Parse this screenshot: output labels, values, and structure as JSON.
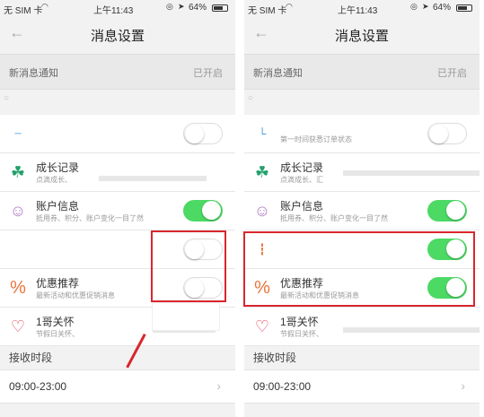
{
  "status_bar": {
    "carrier": "无 SIM 卡",
    "time": "上午11:43",
    "battery": "64%"
  },
  "nav": {
    "title": "消息设置"
  },
  "notice": {
    "label": "新消息通知",
    "value": "已开启"
  },
  "left": {
    "top_partial_desc": "",
    "items": [
      {
        "name": "成长记录",
        "desc": "点滴成长、"
      },
      {
        "name": "账户信息",
        "desc": "抵用券、积分、账户变化一目了然"
      },
      {
        "name": "",
        "desc": ""
      },
      {
        "name": "优惠推荐",
        "desc": "最新活动和优惠促销消息"
      },
      {
        "name": "1哥关怀",
        "desc": "节假日关怀、"
      }
    ]
  },
  "right": {
    "top_partial_desc": "第一时间获悉订单状态",
    "items": [
      {
        "name": "成长记录",
        "desc": "点滴成长、汇"
      },
      {
        "name": "账户信息",
        "desc": "抵用券、积分、账户变化一目了然"
      },
      {
        "name": "",
        "desc": ""
      },
      {
        "name": "优惠推荐",
        "desc": "最新活动和优惠促销消息"
      },
      {
        "name": "1哥关怀",
        "desc": "节假日关怀、"
      }
    ]
  },
  "receive": {
    "section_title": "接收时段",
    "value": "09:00-23:00"
  },
  "toggles": {
    "left": [
      false,
      false,
      true,
      false,
      false
    ],
    "right": [
      false,
      false,
      true,
      true,
      true
    ]
  },
  "colors": {
    "accent_green": "#4cd964",
    "highlight_red": "#d9262c"
  },
  "icons": {
    "back": "back-arrow-icon",
    "growth": "sprout-icon",
    "account": "person-icon",
    "promo": "percent-icon",
    "care": "heart-icon",
    "wifi": "wifi-icon",
    "location": "location-arrow-icon",
    "chevron": "chevron-right-icon"
  }
}
